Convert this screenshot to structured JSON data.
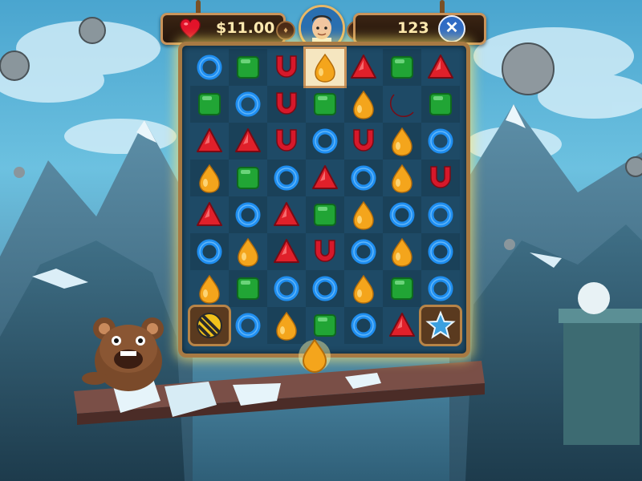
{
  "hud": {
    "money": "$11.00",
    "moves": "123",
    "close_label": "✕"
  },
  "board": {
    "rows": [
      [
        "ring",
        "square",
        "horseshoe",
        "drop",
        "triangle",
        "square",
        "triangle"
      ],
      [
        "square",
        "ring",
        "horseshoe",
        "square",
        "drop",
        "crescent",
        "square"
      ],
      [
        "triangle",
        "triangle",
        "horseshoe",
        "ring",
        "horseshoe",
        "drop",
        "ring"
      ],
      [
        "drop",
        "square",
        "ring",
        "triangle",
        "ring",
        "drop",
        "horseshoe"
      ],
      [
        "triangle",
        "ring",
        "triangle",
        "square",
        "drop",
        "ring",
        "ring"
      ],
      [
        "ring",
        "drop",
        "triangle",
        "horseshoe",
        "ring",
        "drop",
        "ring"
      ],
      [
        "drop",
        "square",
        "ring",
        "ring",
        "drop",
        "square",
        "ring"
      ],
      [
        "striped-ball",
        "ring",
        "drop",
        "square",
        "ring",
        "triangle",
        "star"
      ]
    ],
    "selected": {
      "row": 0,
      "col": 3
    },
    "falling_piece": "drop"
  },
  "colors": {
    "ring": "#1f8ef0",
    "square": "#21a535",
    "horseshoe": "#d6182a",
    "drop": "#f4a51c",
    "triangle": "#e0202a",
    "crescent": "#d6182a",
    "star": "#3aa0e0",
    "board_frame": "#a87a43",
    "hud_border": "#c9935a"
  },
  "icons": {
    "lives": "heart-icon",
    "coin_left": "coin-icon",
    "coin_right": "coin-icon",
    "close": "close-icon",
    "avatar": "player-avatar",
    "mascot": "bear-mascot",
    "booster_left": "striped-ball-icon",
    "booster_right": "star-icon"
  }
}
